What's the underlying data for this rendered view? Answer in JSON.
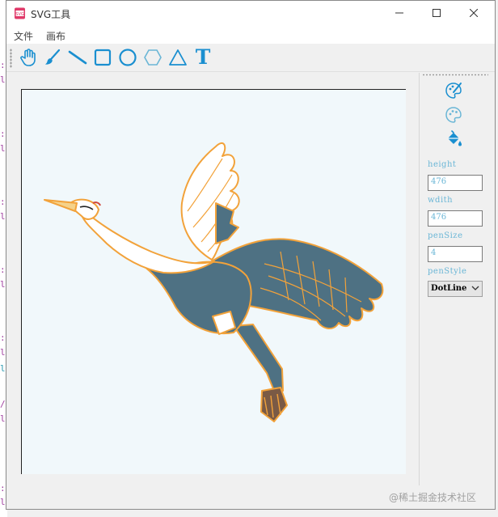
{
  "window": {
    "title": "SVG工具",
    "app_icon": "svg-app-icon",
    "icon_text": "SVG"
  },
  "menu": {
    "items": [
      "文件",
      "画布"
    ]
  },
  "toolbar": {
    "tools": [
      "hand-icon",
      "brush-icon",
      "line-icon",
      "rectangle-icon",
      "circle-icon",
      "hexagon-icon",
      "triangle-icon",
      "text-tool-icon"
    ],
    "text_tool_glyph": "T"
  },
  "sidebar": {
    "icons": [
      "color-palette-brush-icon",
      "palette-icon",
      "paint-bucket-icon"
    ],
    "fields": [
      {
        "label": "height",
        "value": "476"
      },
      {
        "label": "wdith",
        "value": "476"
      },
      {
        "label": "penSize",
        "value": "4"
      }
    ],
    "pen_style": {
      "label": "penStyle",
      "selected": "DotLine"
    }
  },
  "canvas": {
    "image": "flying-crane-illustration"
  },
  "colors": {
    "accent": "#1a8fd0",
    "field_text": "#6ab6d6",
    "crane_body": "#4e7183",
    "crane_outline": "#f2a23a"
  },
  "watermark": "@稀土掘金技术社区"
}
